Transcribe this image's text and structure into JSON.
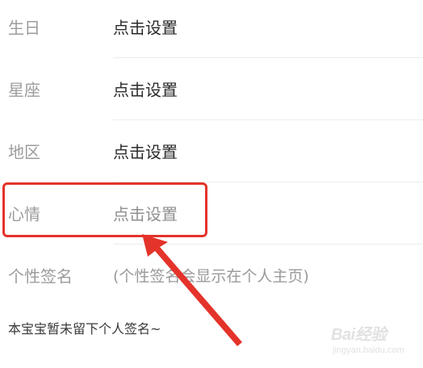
{
  "profile_rows": [
    {
      "label": "生日",
      "value": "点击设置"
    },
    {
      "label": "星座",
      "value": "点击设置"
    },
    {
      "label": "地区",
      "value": "点击设置"
    },
    {
      "label": "心情",
      "value": "点击设置"
    },
    {
      "label": "个性签名",
      "value": "(个性签名会显示在个人主页)"
    }
  ],
  "signature": {
    "text": "本宝宝暂未留下个人签名~"
  },
  "annotation": {
    "highlight_color": "#e4332a"
  },
  "watermark": {
    "brand": "Bai经验",
    "sub": "经验",
    "url": "jingyan.baidu.com"
  }
}
